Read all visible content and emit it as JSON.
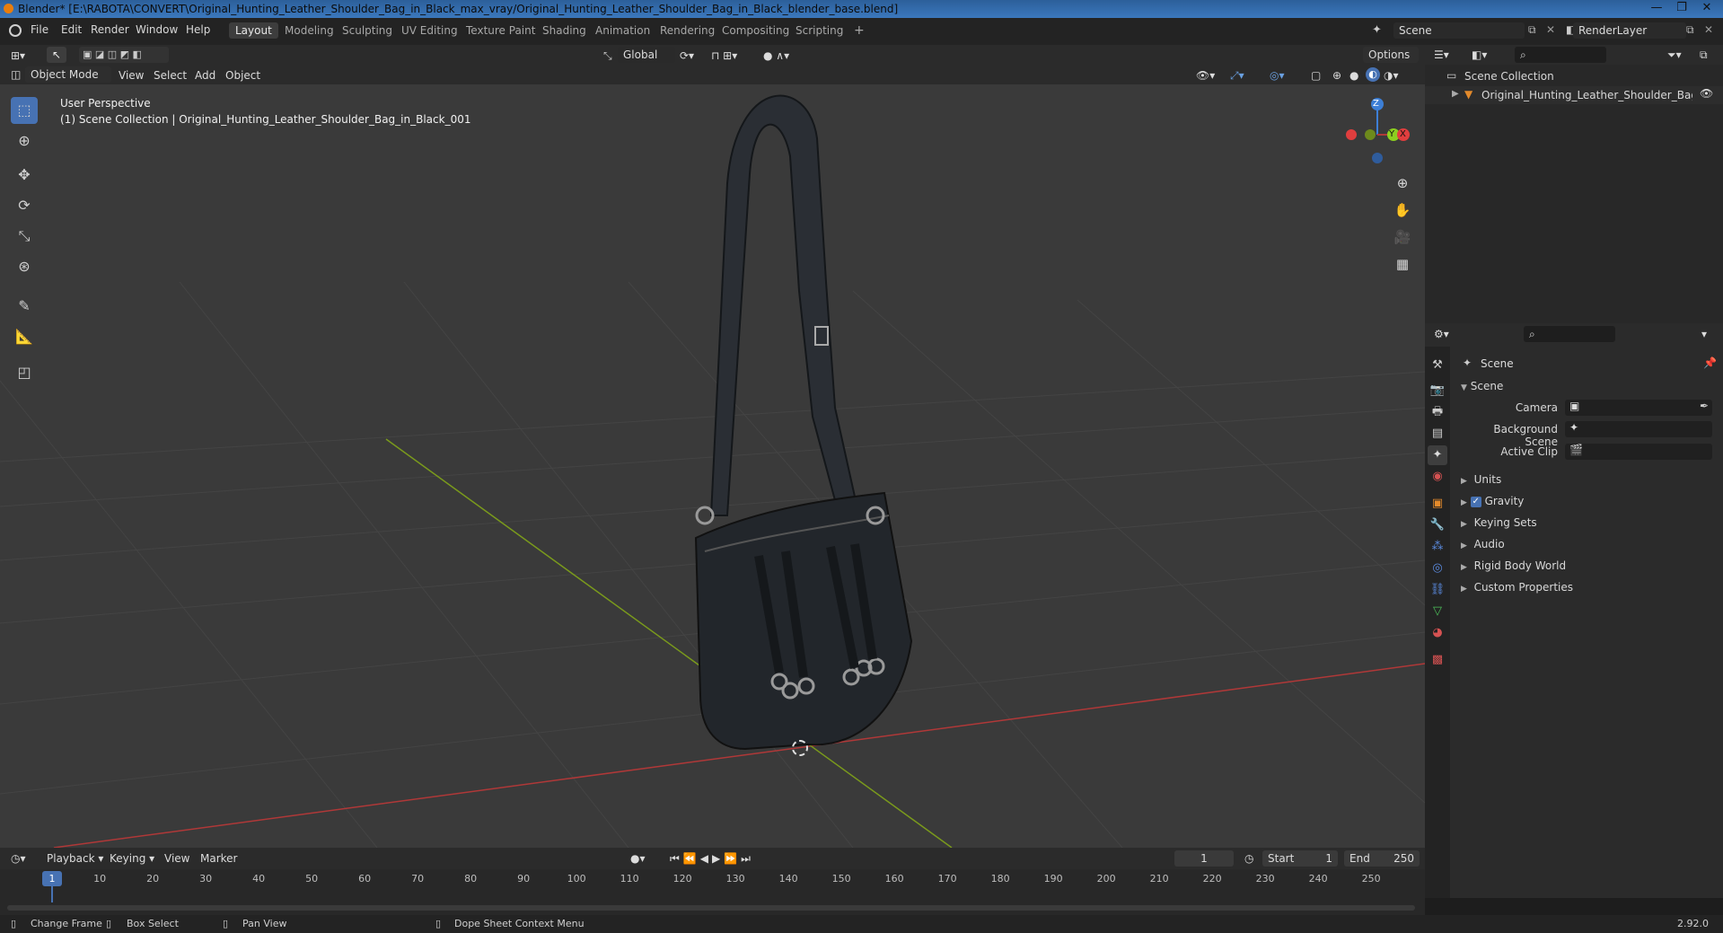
{
  "window": {
    "title": "Blender* [E:\\RABOTA\\CONVERT\\Original_Hunting_Leather_Shoulder_Bag_in_Black_max_vray/Original_Hunting_Leather_Shoulder_Bag_in_Black_blender_base.blend]",
    "controls": [
      "—",
      "❐",
      "✕"
    ]
  },
  "menubar": {
    "items": [
      "File",
      "Edit",
      "Render",
      "Window",
      "Help"
    ]
  },
  "workspaces": {
    "tabs": [
      "Layout",
      "Modeling",
      "Sculpting",
      "UV Editing",
      "Texture Paint",
      "Shading",
      "Animation",
      "Rendering",
      "Compositing",
      "Scripting"
    ],
    "active": "Layout",
    "add_label": "+"
  },
  "scene_selector": {
    "value": "Scene"
  },
  "renderlayer_selector": {
    "value": "RenderLayer"
  },
  "viewport_header": {
    "transform_orientation": "Global",
    "options_label": "Options",
    "mode": "Object Mode",
    "menus": [
      "View",
      "Select",
      "Add",
      "Object"
    ]
  },
  "viewport": {
    "perspective_label": "User Perspective",
    "collection_label": "(1) Scene Collection | Original_Hunting_Leather_Shoulder_Bag_in_Black_001",
    "gizmo": {
      "z": "Z",
      "y": "Y",
      "x": "X"
    },
    "colors": {
      "x_axis": "#b03838",
      "y_axis": "#7a9a1c",
      "z_axis": "#3d7fd6"
    }
  },
  "toolbar": {
    "tools": [
      "select-box-icon",
      "cursor-icon",
      "move-icon",
      "rotate-icon",
      "scale-icon",
      "transform-icon",
      "annotate-icon",
      "measure-icon",
      "add-cube-icon"
    ],
    "active": "select-box-icon"
  },
  "outliner": {
    "root": "Scene Collection",
    "items": [
      {
        "label": "Original_Hunting_Leather_Shoulder_Bag_in_Bl"
      }
    ]
  },
  "properties": {
    "context_title": "Scene",
    "panel_title": "Scene",
    "fields": [
      {
        "label": "Camera"
      },
      {
        "label": "Background Scene"
      },
      {
        "label": "Active Clip"
      }
    ],
    "sections": [
      {
        "label": "Units",
        "checkbox": false
      },
      {
        "label": "Gravity",
        "checkbox": true
      },
      {
        "label": "Keying Sets",
        "checkbox": false
      },
      {
        "label": "Audio",
        "checkbox": false
      },
      {
        "label": "Rigid Body World",
        "checkbox": false
      },
      {
        "label": "Custom Properties",
        "checkbox": false
      }
    ],
    "tabs": [
      "tool-icon",
      "render-icon",
      "output-icon",
      "view-layer-icon",
      "scene-icon",
      "world-icon",
      "object-icon",
      "modifier-icon",
      "particles-icon",
      "physics-icon",
      "constraints-icon",
      "data-icon",
      "material-icon",
      "texture-icon"
    ],
    "active_tab": "scene-icon"
  },
  "timeline": {
    "menus": [
      "Playback",
      "Keying",
      "View",
      "Marker"
    ],
    "current_frame": "1",
    "start_label": "Start",
    "start": "1",
    "end_label": "End",
    "end": "250",
    "ruler": [
      "1",
      "10",
      "20",
      "30",
      "40",
      "50",
      "60",
      "70",
      "80",
      "90",
      "100",
      "110",
      "120",
      "130",
      "140",
      "150",
      "160",
      "170",
      "180",
      "190",
      "200",
      "210",
      "220",
      "230",
      "240",
      "250"
    ]
  },
  "statusbar": {
    "items": [
      "Change Frame",
      "Box Select",
      "Pan View",
      "Dope Sheet Context Menu"
    ],
    "version": "2.92.0"
  }
}
